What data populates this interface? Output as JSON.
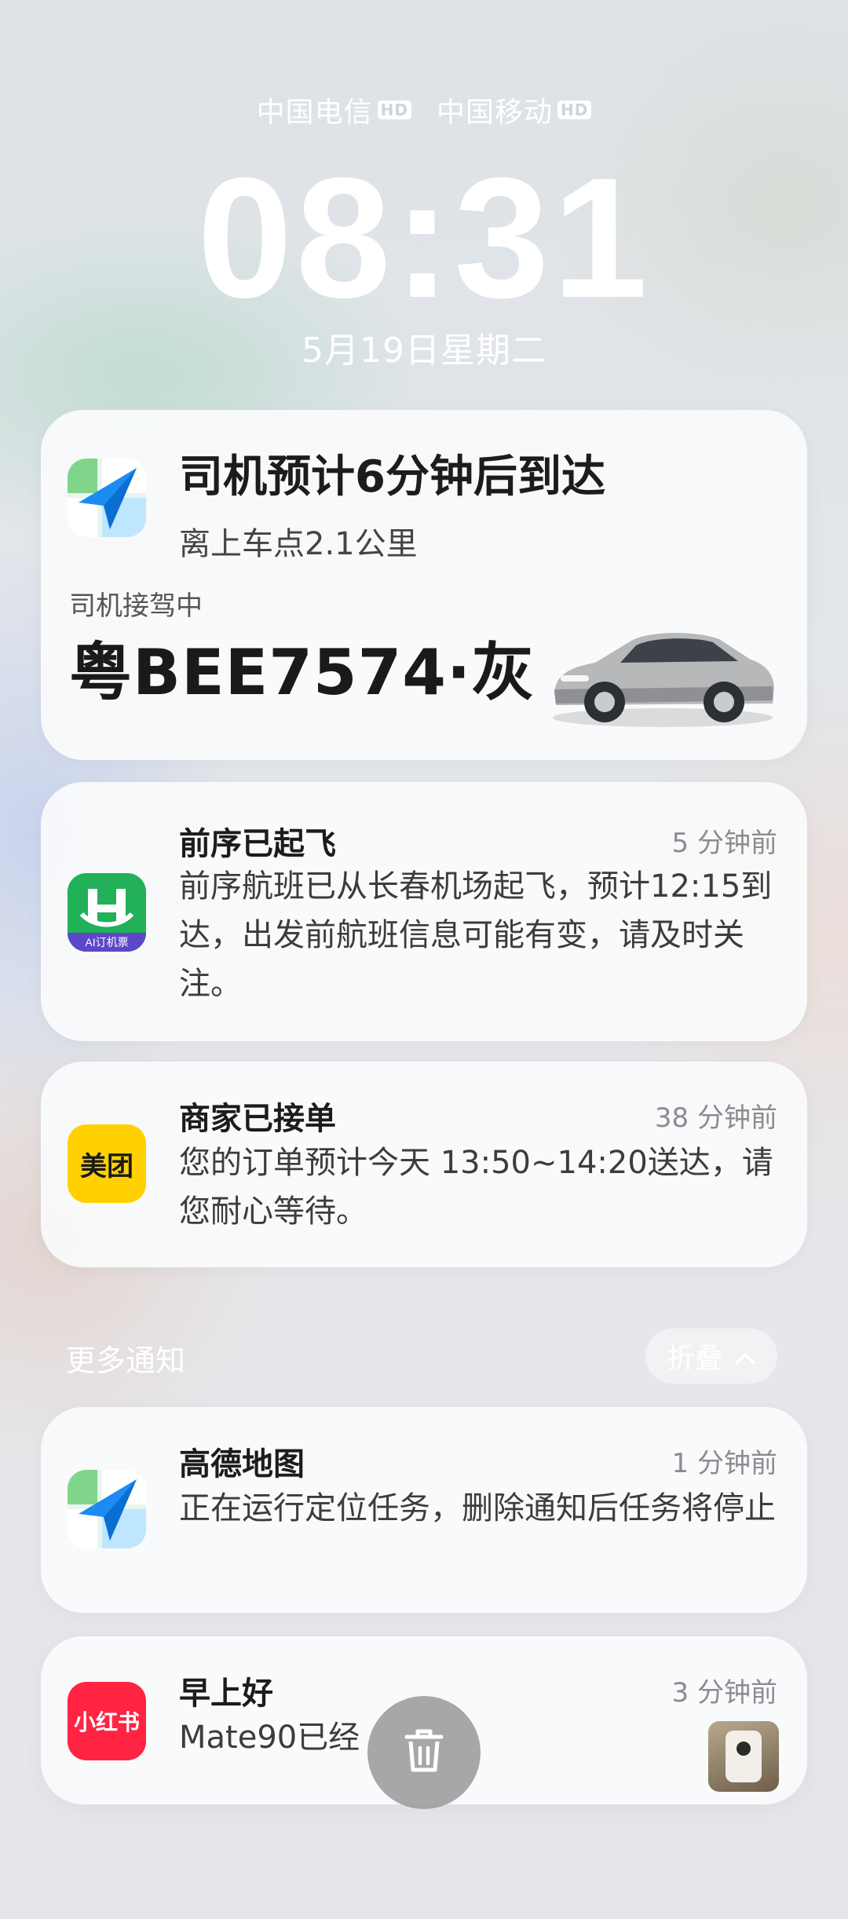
{
  "status": {
    "carrier1": "中国电信",
    "carrier2": "中国移动",
    "hd_badge": "HD"
  },
  "lock": {
    "time": "08:31",
    "date": "5月19日星期二"
  },
  "taxi_card": {
    "title": "司机预计6分钟后到达",
    "subtitle": "离上车点2.1公里",
    "status": "司机接驾中",
    "plate": "粤BEE7574·灰",
    "icon": "amap-icon"
  },
  "notifications": [
    {
      "app_icon": "ai-flight-icon",
      "icon_caption": "AI订机票",
      "title": "前序已起飞",
      "time": "5 分钟前",
      "body": "前序航班已从长春机场起飞，预计12:15到达，出发前航班信息可能有变，请及时关注。"
    },
    {
      "app_icon": "meituan-icon",
      "icon_caption": "美团",
      "title": "商家已接单",
      "time": "38 分钟前",
      "body": "您的订单预计今天 13:50~14:20送达，请您耐心等待。"
    }
  ],
  "more": {
    "label": "更多通知",
    "fold_label": "折叠"
  },
  "more_notifications": [
    {
      "app_icon": "amap-icon",
      "title": "高德地图",
      "time": "1 分钟前",
      "body": "正在运行定位任务，删除通知后任务将停止"
    },
    {
      "app_icon": "xiaohongshu-icon",
      "icon_caption": "小红书",
      "title": "早上好",
      "time": "3 分钟前",
      "body": "Mate90已经"
    }
  ],
  "colors": {
    "meituan_yellow": "#FFD100",
    "xhs_red": "#FF2442",
    "flight_green": "#1FA84F"
  }
}
